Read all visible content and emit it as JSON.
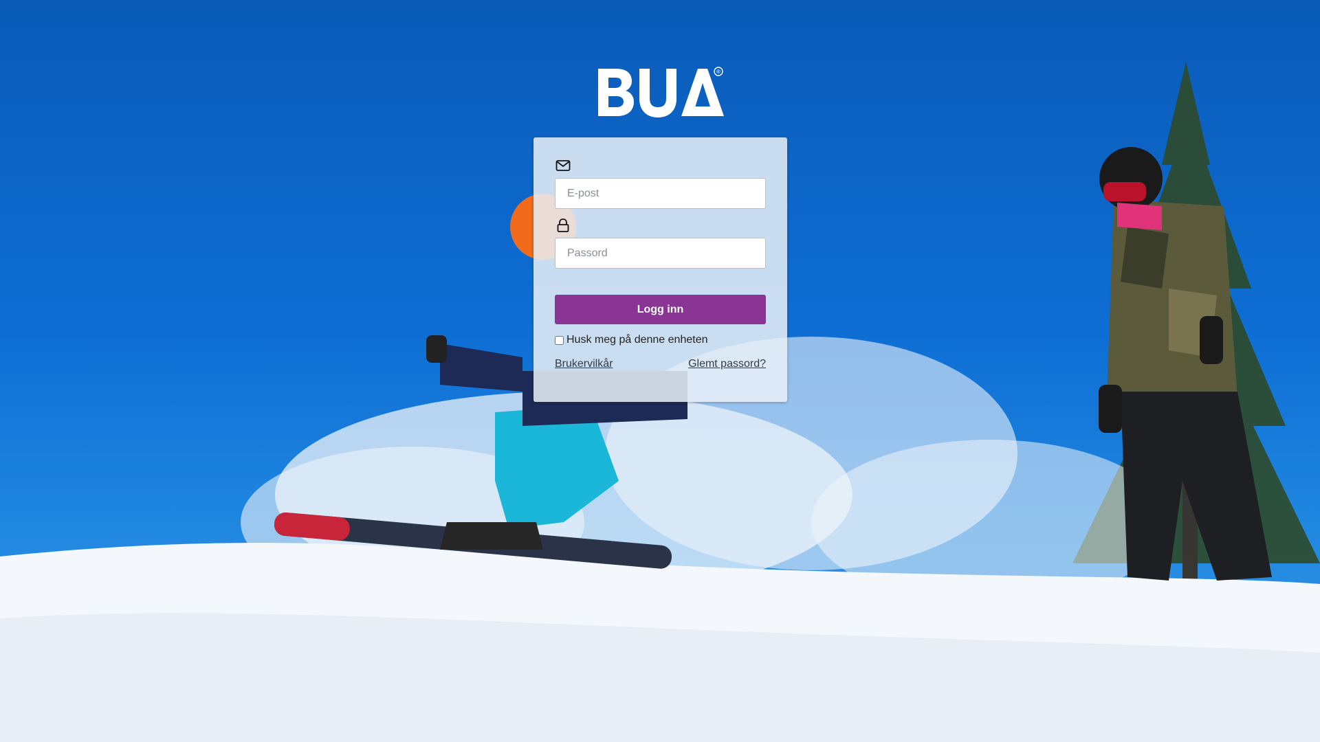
{
  "brand": {
    "logo_text": "BUA",
    "trademark": "®"
  },
  "login": {
    "email_icon": "envelope-icon",
    "email_placeholder": "E-post",
    "email_value": "",
    "password_icon": "lock-icon",
    "password_placeholder": "Passord",
    "password_value": "",
    "submit_label": "Logg inn",
    "remember_label": "Husk meg på denne enheten",
    "remember_checked": false,
    "terms_link": "Brukervilkår",
    "forgot_link": "Glemt passord?"
  },
  "colors": {
    "primary_button": "#8a3596",
    "sky": "#0e6ed4",
    "card_bg": "#e9f0f7"
  }
}
